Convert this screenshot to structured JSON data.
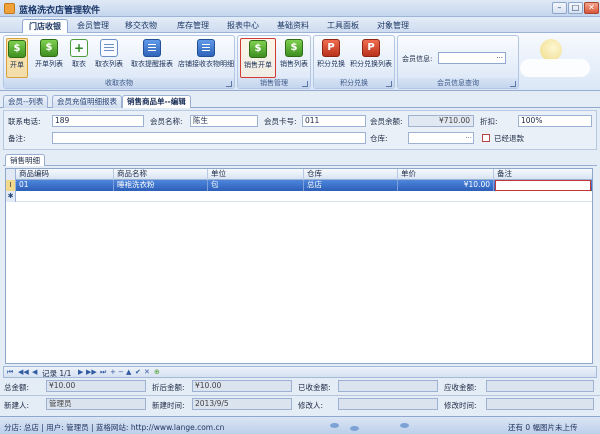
{
  "window": {
    "title": "蓝格洗衣店管理软件",
    "minimize": "–",
    "maximize": "□",
    "close": "✕"
  },
  "menu": [
    "门店收银",
    "会员管理",
    "移交衣物",
    "库存管理",
    "报表中心",
    "基础资料",
    "工具面板",
    "对象管理"
  ],
  "ribbon": {
    "group1": {
      "label": "收取衣物",
      "buttons": [
        "开单",
        "开单列表",
        "取衣",
        "取衣列表",
        "取衣提醒报表",
        "店铺接收衣物明细"
      ]
    },
    "group2": {
      "label": "销售管理",
      "buttons": [
        "销售开单",
        "销售列表"
      ]
    },
    "group3": {
      "label": "积分兑换",
      "buttons": [
        "积分兑换",
        "积分兑换列表"
      ]
    },
    "group4": {
      "label": "会员信息查询",
      "member_info_label": "会员信息:",
      "member_info_value": "···"
    }
  },
  "doc_tabs": [
    "会员--列表",
    "会员充值明细报表",
    "销售商品单--编辑"
  ],
  "form": {
    "phone_label": "联系电话:",
    "phone": "189",
    "name_label": "会员名称:",
    "name": "陈生",
    "card_label": "会员卡号:",
    "card": "011",
    "balance_label": "会员余额:",
    "balance": "¥710.00",
    "discount_label": "折扣:",
    "discount": "100%",
    "note_label": "备注:",
    "note": "",
    "warehouse_label": "仓库:",
    "warehouse": "",
    "returned_label": "已经退款"
  },
  "sub_tab": "销售明细",
  "grid": {
    "columns": [
      "商品编码",
      "商品名称",
      "单位",
      "仓库",
      "单价",
      "备注"
    ],
    "rows": [
      {
        "code": "01",
        "name": "睡袍洗衣粉",
        "unit": "包",
        "warehouse": "总店",
        "price": "¥10.00",
        "note": ""
      }
    ]
  },
  "navigator": {
    "record": "记录 1/1"
  },
  "totals": {
    "total_label": "总金额:",
    "total": "¥10.00",
    "discount_total_label": "折后金额:",
    "discount_total": "¥10.00",
    "received_label": "已收金额:",
    "received": "",
    "receivable_label": "应收金额:",
    "receivable": "",
    "creator_label": "新建人:",
    "creator": "管理员",
    "created_label": "新建时间:",
    "created": "2013/9/5",
    "modifier_label": "修改人:",
    "modifier": "",
    "modified_label": "修改时间:",
    "modified": ""
  },
  "status": {
    "left": "分店: 总店 | 用户: 管理员 | 蓝格网站: http://www.lange.com.cn",
    "right": "还有 0 幅图片未上传"
  }
}
